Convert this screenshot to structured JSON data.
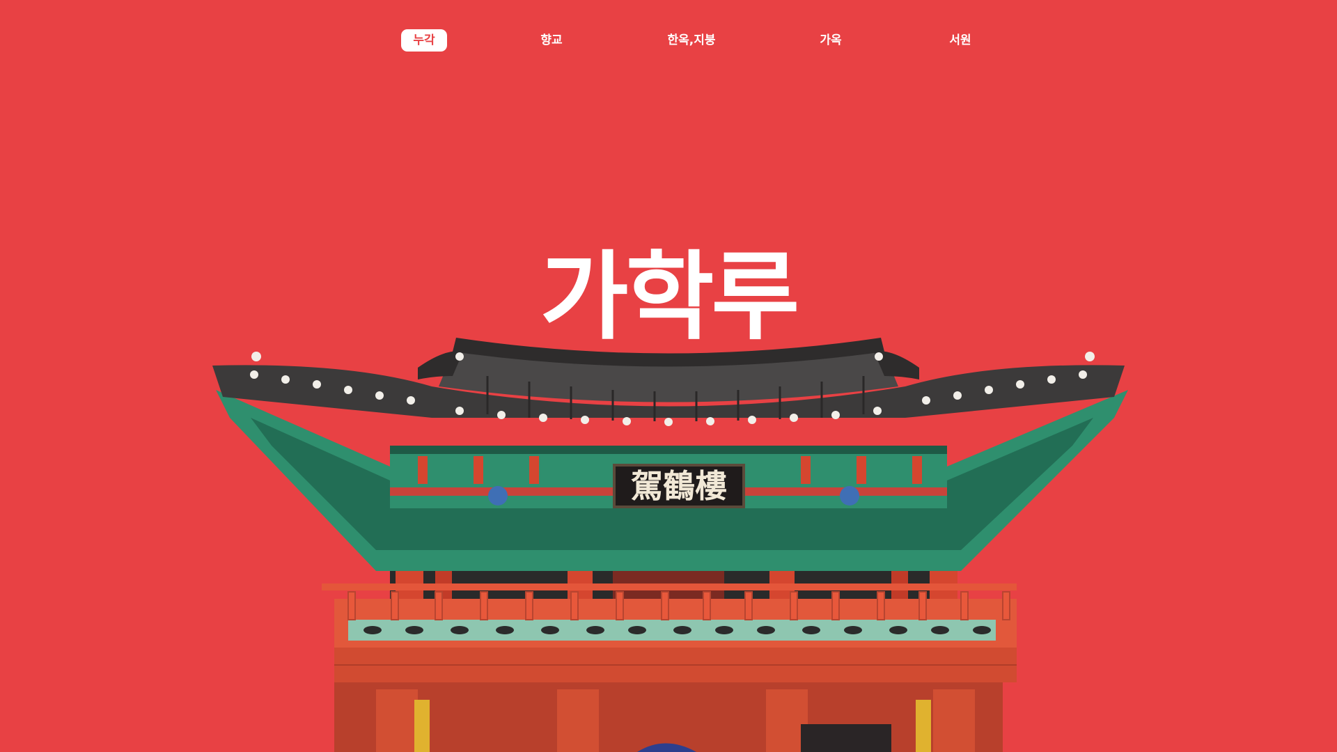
{
  "nav": {
    "items": [
      {
        "label": "누각",
        "active": true
      },
      {
        "label": "향교",
        "active": false
      },
      {
        "label": "한옥,지붕",
        "active": false
      },
      {
        "label": "가옥",
        "active": false
      },
      {
        "label": "서원",
        "active": false
      }
    ]
  },
  "hero": {
    "title": "가학루",
    "plaque": "駕鶴樓"
  },
  "colors": {
    "background": "#e84144",
    "nav_active_bg": "#ffffff",
    "text": "#ffffff",
    "roof_tile": "#3c3a3a",
    "dancheong_green": "#2f8f6e",
    "pillar_red": "#d5462f"
  },
  "icons": {
    "illustration": "traditional-korean-pavilion-illustration"
  }
}
